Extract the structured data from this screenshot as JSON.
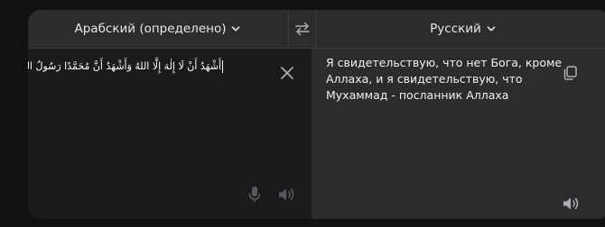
{
  "translator": {
    "source_language": "Арабский (определено)",
    "target_language": "Русский",
    "source_text": "أَشْهَدُ أَنْ لَا إِلٰهَ إِلَّا اللهُ وَأَشْهَدُ أَنَّ مُحَمَّدًا رَسُولُ اللهِ",
    "translated_text": "Я свидетельствую, что нет Бога, кроме Аллаха, и я свидетельствую, что Мухаммад - посланник Аллаха"
  },
  "icons": {
    "swap": "swap-arrows-icon",
    "chevron": "chevron-down-icon",
    "clear": "close-icon",
    "mic": "microphone-icon",
    "speaker": "speaker-icon",
    "copy": "copy-icon"
  },
  "colors": {
    "background": "#111112",
    "header": "#2c2c2e",
    "source_pane": "#1b1b1d",
    "target_pane": "#2c2c2e",
    "text": "#ffffff",
    "icon": "#8e8e93"
  }
}
